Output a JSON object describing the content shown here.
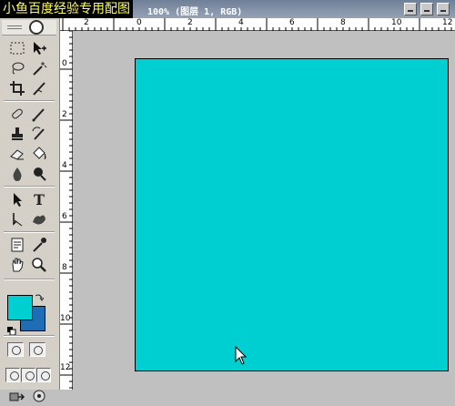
{
  "watermark": "小鱼百度经验专用配图",
  "document": {
    "title": "100% (图层 1, RGB)"
  },
  "colors": {
    "canvas": "#00cfd2",
    "foreground": "#00cfd2",
    "background": "#1f6db5",
    "workspace": "#c0c0c0"
  },
  "tools": [
    {
      "name": "marquee-tool-icon"
    },
    {
      "name": "move-tool-icon"
    },
    {
      "name": "lasso-tool-icon"
    },
    {
      "name": "magic-wand-tool-icon"
    },
    {
      "name": "crop-tool-icon"
    },
    {
      "name": "slice-tool-icon"
    },
    {
      "name": "healing-brush-tool-icon"
    },
    {
      "name": "brush-tool-icon"
    },
    {
      "name": "clone-stamp-tool-icon"
    },
    {
      "name": "history-brush-tool-icon"
    },
    {
      "name": "eraser-tool-icon"
    },
    {
      "name": "paint-bucket-tool-icon"
    },
    {
      "name": "blur-tool-icon"
    },
    {
      "name": "dodge-tool-icon"
    },
    {
      "name": "path-selection-tool-icon"
    },
    {
      "name": "type-tool-icon"
    },
    {
      "name": "pen-tool-icon"
    },
    {
      "name": "custom-shape-tool-icon"
    },
    {
      "name": "notes-tool-icon"
    },
    {
      "name": "eyedropper-tool-icon"
    },
    {
      "name": "hand-tool-icon"
    },
    {
      "name": "zoom-tool-icon"
    }
  ],
  "type_tool_glyph": "T",
  "ruler_top": [
    "2",
    "0",
    "2",
    "4",
    "6",
    "8",
    "10",
    "12"
  ],
  "ruler_left": [
    "0",
    "2",
    "4",
    "6",
    "8",
    "10",
    "12"
  ]
}
